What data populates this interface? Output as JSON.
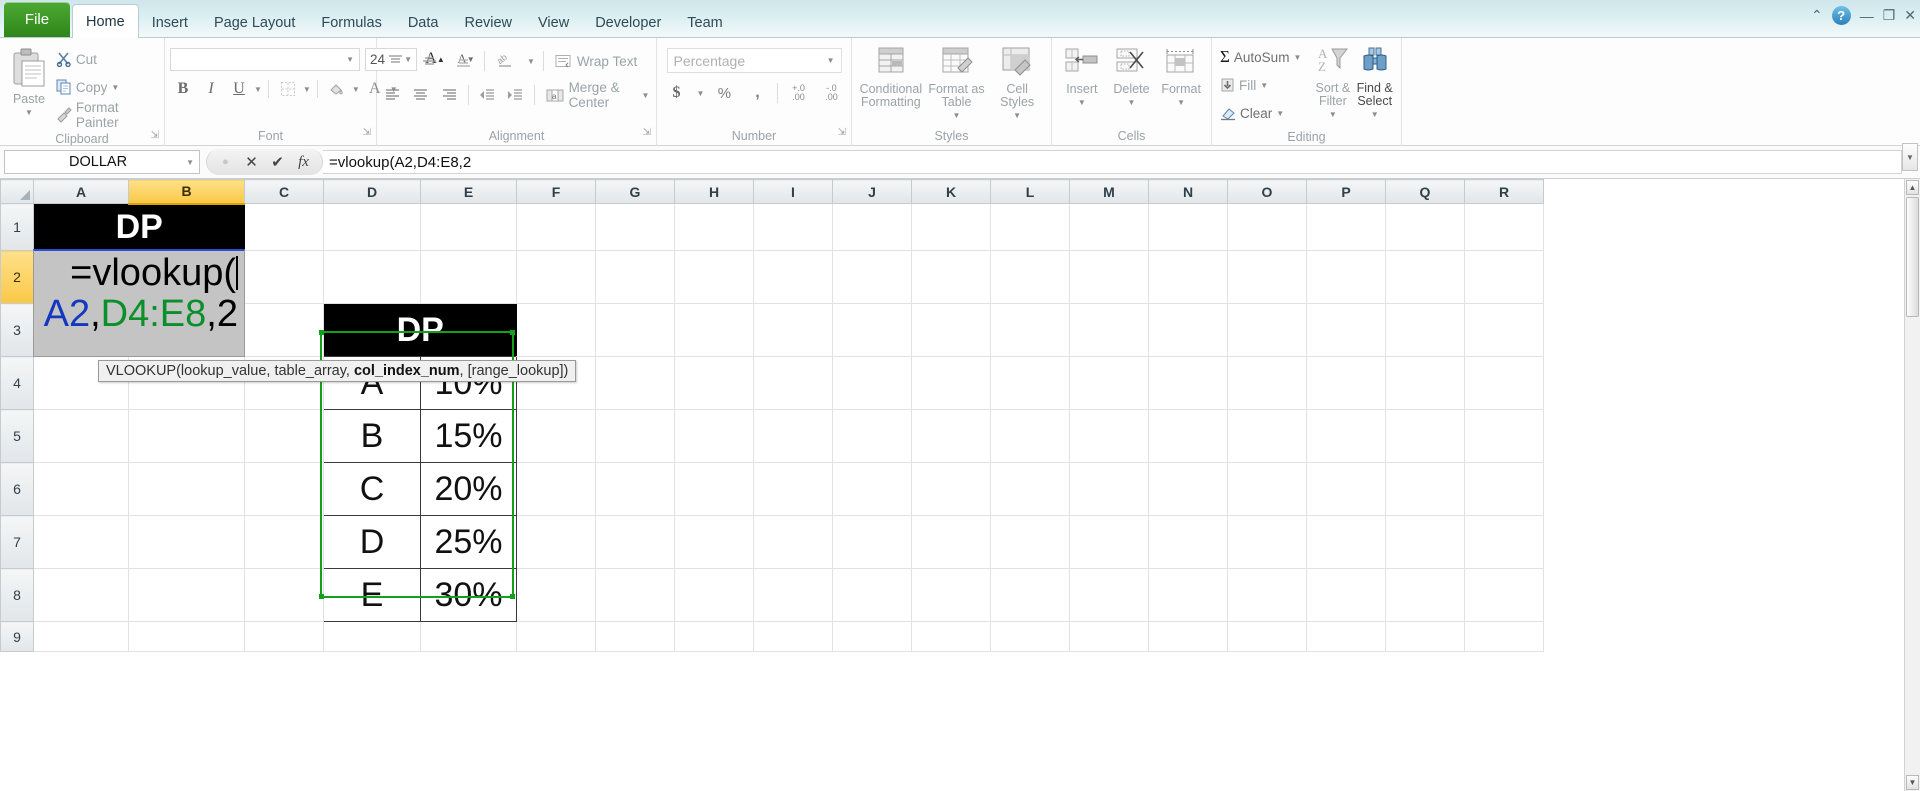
{
  "window": {
    "file_tab": "File",
    "tabs": [
      "Home",
      "Insert",
      "Page Layout",
      "Formulas",
      "Data",
      "Review",
      "View",
      "Developer",
      "Team"
    ],
    "active_tab": "Home",
    "controls": {
      "minimize_ribbon": "⌃",
      "help": "?",
      "minimize": "—",
      "restore": "❐",
      "close": "✕"
    }
  },
  "ribbon": {
    "groups": [
      {
        "name": "Clipboard",
        "label": "Clipboard"
      },
      {
        "name": "Font",
        "label": "Font"
      },
      {
        "name": "Alignment",
        "label": "Alignment"
      },
      {
        "name": "Number",
        "label": "Number"
      },
      {
        "name": "Styles",
        "label": "Styles"
      },
      {
        "name": "Cells",
        "label": "Cells"
      },
      {
        "name": "Editing",
        "label": "Editing"
      }
    ],
    "clipboard": {
      "paste": "Paste",
      "cut": "Cut",
      "copy": "Copy",
      "format_painter": "Format Painter"
    },
    "font": {
      "font_name": "",
      "font_name_placeholder": "",
      "font_size": "24",
      "bold": "B",
      "italic": "I",
      "underline": "U",
      "grow_font": "A",
      "shrink_font": "A",
      "borders_icon": "borders-icon",
      "fill_color_icon": "fill-color-icon",
      "font_color_icon": "font-color-icon"
    },
    "alignment": {
      "wrap_text": "Wrap Text",
      "merge_center": "Merge & Center",
      "orientation_icon": "orientation-icon",
      "decrease_indent_icon": "decrease-indent-icon",
      "increase_indent_icon": "increase-indent-icon"
    },
    "number": {
      "format": "Percentage",
      "accounting": "$",
      "percent": "%",
      "comma": ",",
      "increase_decimal": "+.0",
      "decrease_decimal": "-.0",
      "decimal_sub": ".00"
    },
    "styles": {
      "conditional_formatting": "Conditional Formatting",
      "format_as_table": "Format as Table",
      "cell_styles": "Cell Styles"
    },
    "cells": {
      "insert": "Insert",
      "delete": "Delete",
      "format": "Format"
    },
    "editing": {
      "autosum": "AutoSum",
      "fill": "Fill",
      "clear": "Clear",
      "sort_filter": "Sort & Filter",
      "find_select": "Find & Select",
      "sigma": "Σ"
    }
  },
  "formula_bar": {
    "name_box": "DOLLAR",
    "cancel": "✕",
    "enter": "✔",
    "insert_function": "fx",
    "formula": "=vlookup(A2,D4:E8,2"
  },
  "grid": {
    "column_headers": [
      "A",
      "B",
      "C",
      "D",
      "E",
      "F",
      "G",
      "H",
      "I",
      "J",
      "K",
      "L",
      "M",
      "N",
      "O",
      "P",
      "Q",
      "R"
    ],
    "selected_column": "B",
    "row_headers": [
      "1",
      "2",
      "3",
      "4",
      "5",
      "6",
      "7",
      "8",
      "9"
    ],
    "selected_row": "2",
    "cells": {
      "B1": "DP",
      "E3": "DP",
      "D4": "A",
      "E4": "10%",
      "D5": "B",
      "E5": "15%",
      "D6": "C",
      "E6": "20%",
      "D7": "D",
      "E7": "25%",
      "D8": "E",
      "E8": "30%"
    }
  },
  "editing_cell": {
    "address": "A2",
    "prefix": "=vlookup(",
    "arg1": "A2",
    "sep1": ",",
    "arg2": "D4:E8",
    "sep2": ",",
    "arg3": "2"
  },
  "tooltip": {
    "before": "VLOOKUP(lookup_value, table_array, ",
    "bold": "col_index_num",
    "after": ", [range_lookup])"
  },
  "colors": {
    "file_tab_green": "#3f9a27",
    "selected_header": "#f9c846",
    "range_border_green": "#11a11a",
    "ref_blue": "#1338be",
    "ref_green": "#0a8f2a",
    "edit_cell_bg": "#c4c4c4"
  }
}
